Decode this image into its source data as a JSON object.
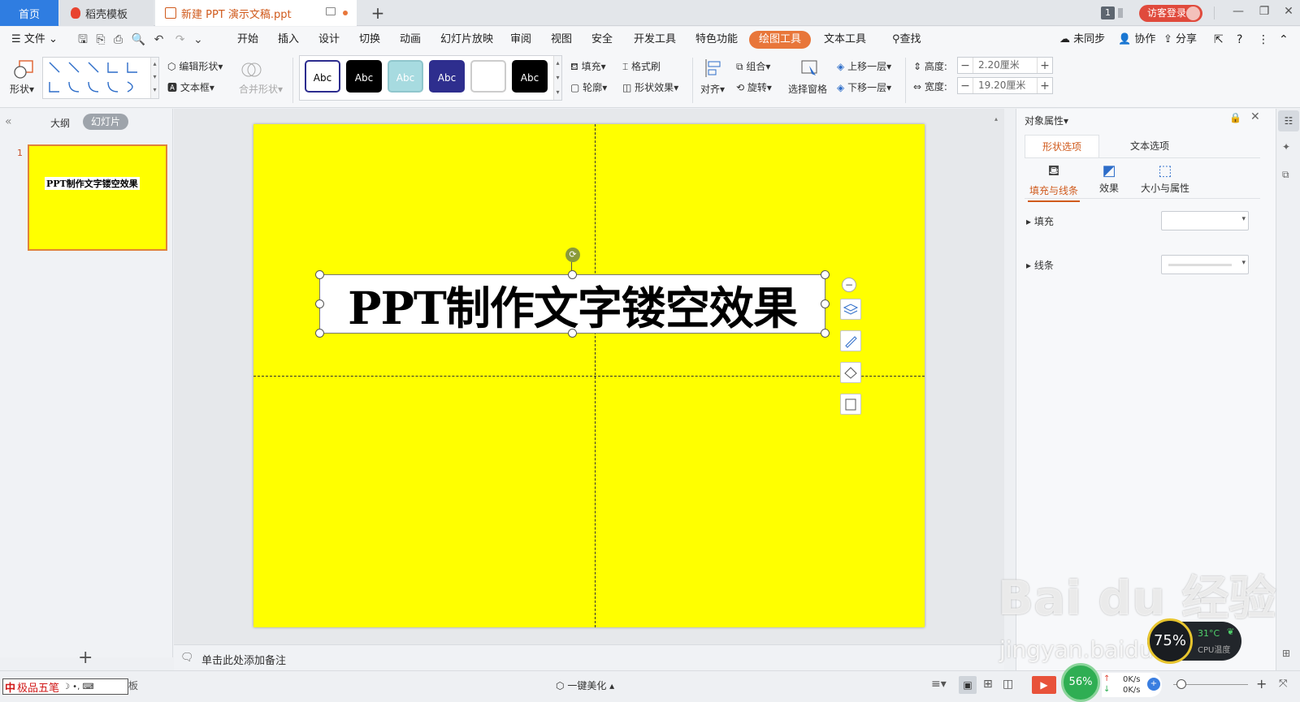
{
  "tabbar": {
    "home": "首页",
    "template_tab": "稻壳模板",
    "doc_tab": "新建 PPT 演示文稿.ppt",
    "page_badge": "1",
    "login": "访客登录"
  },
  "menu": {
    "file": "文件",
    "items": [
      "开始",
      "插入",
      "设计",
      "切换",
      "动画",
      "幻灯片放映",
      "审阅",
      "视图",
      "安全",
      "开发工具",
      "特色功能",
      "绘图工具",
      "文本工具"
    ],
    "search": "查找",
    "sync": "未同步",
    "collab": "协作",
    "share": "分享"
  },
  "ribbon": {
    "shape": "形状",
    "edit_shape": "编辑形状",
    "textbox": "文本框",
    "merge_shape": "合并形状",
    "styles": [
      {
        "label": "Abc",
        "bg": "#ffffff",
        "fg": "#000000",
        "border": "#2d2d8f"
      },
      {
        "label": "Abc",
        "bg": "#000000",
        "fg": "#ffffff",
        "border": "#000000"
      },
      {
        "label": "Abc",
        "bg": "#a7dbe0",
        "fg": "#ffffff",
        "border": "#8fc6cc"
      },
      {
        "label": "Abc",
        "bg": "#2e2e8e",
        "fg": "#ffffff",
        "border": "#2e2e8e"
      },
      {
        "label": "",
        "bg": "#ffffff",
        "fg": "#000000",
        "border": "#cccccc"
      },
      {
        "label": "Abc",
        "bg": "#000000",
        "fg": "#ffffff",
        "border": "#000000"
      }
    ],
    "fill": "填充",
    "format_painter": "格式刷",
    "outline": "轮廓",
    "shape_effect": "形状效果",
    "align": "对齐",
    "group": "组合",
    "rotate": "旋转",
    "selection_pane": "选择窗格",
    "bring_forward": "上移一层",
    "send_backward": "下移一层",
    "height_label": "高度:",
    "height_value": "2.20厘米",
    "width_label": "宽度:",
    "width_value": "19.20厘米"
  },
  "leftpanel": {
    "outline_tab": "大纲",
    "slides_tab": "幻灯片",
    "slide_number": "1",
    "thumb_text": "PPT制作文字镂空效果"
  },
  "slide": {
    "title": "PPT制作文字镂空效果",
    "bg_color": "#ffff00"
  },
  "notes": {
    "placeholder": "单击此处添加备注"
  },
  "rightpanel": {
    "title": "对象属性",
    "tab_shape": "形状选项",
    "tab_text": "文本选项",
    "sub_fill_line": "填充与线条",
    "sub_effect": "效果",
    "sub_size": "大小与属性",
    "fill": "填充",
    "line": "线条"
  },
  "statusbar": {
    "ime": "极品五笔",
    "ime_suffix": "板",
    "beautify": "一键美化",
    "cpu_percent": "56%",
    "net_up": "0K/s",
    "net_down": "0K/s",
    "gauge_percent": "75%",
    "temp": "31°C",
    "temp_label": "CPU温度"
  },
  "watermark": {
    "brand": "Bai du 经验",
    "url": "jingyan.baidu.com"
  }
}
